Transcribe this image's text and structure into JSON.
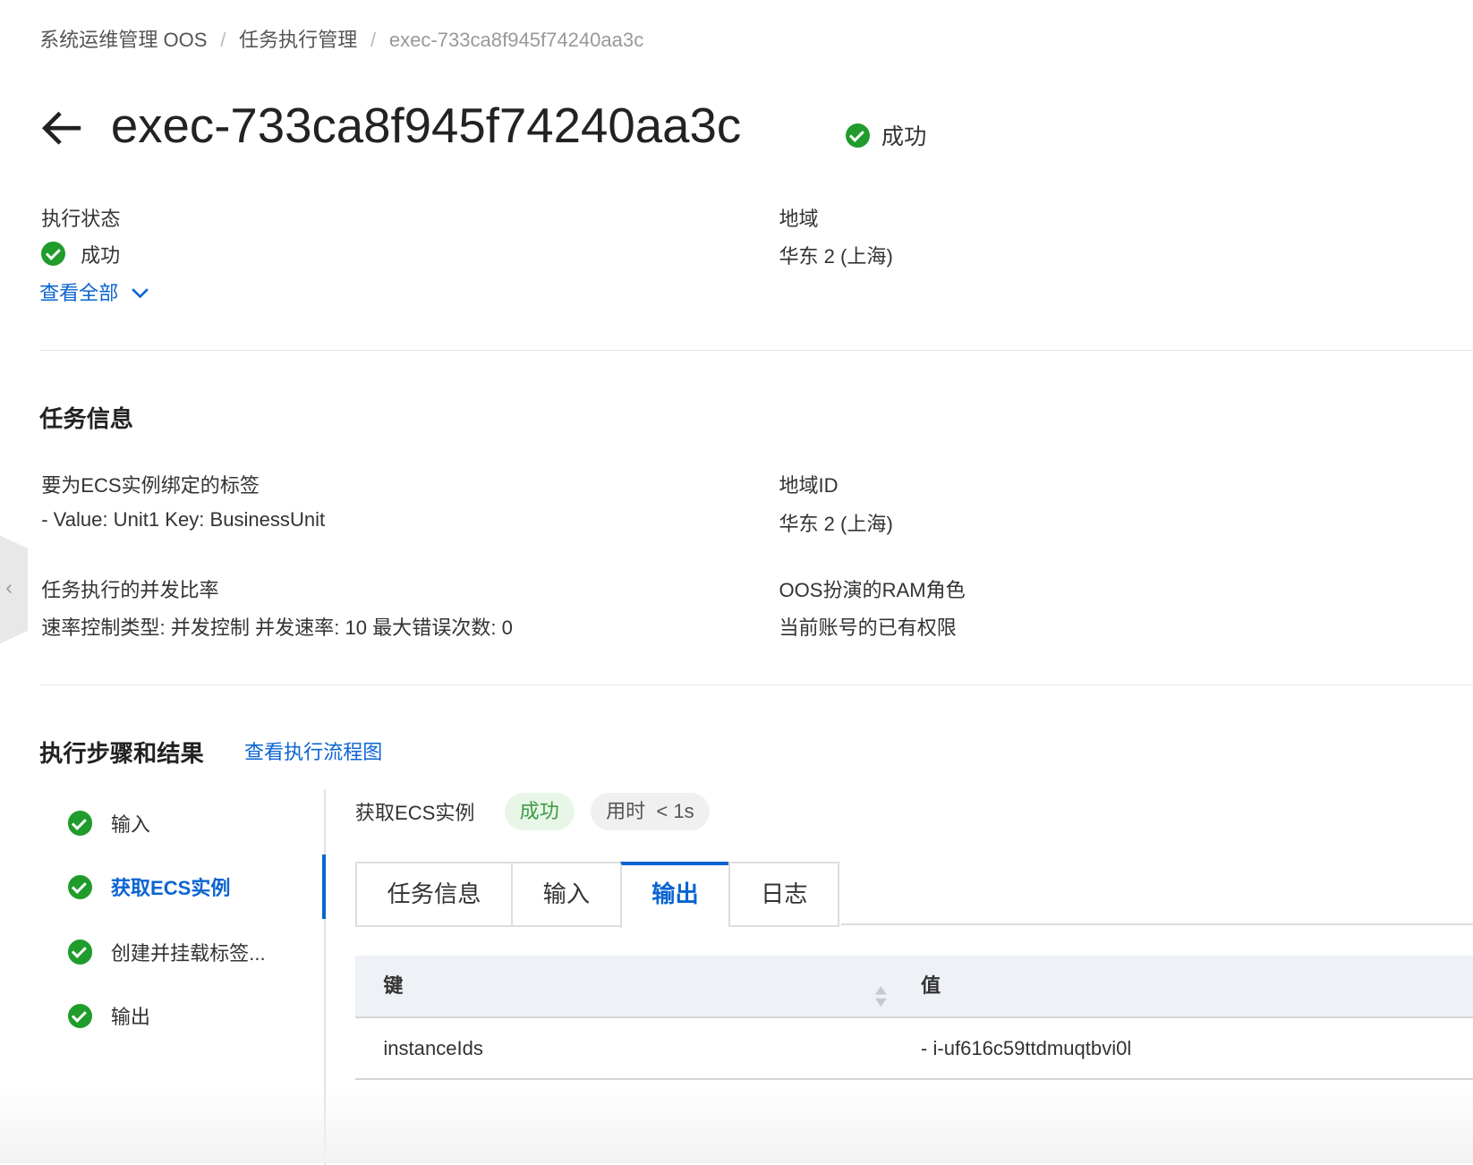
{
  "breadcrumb": [
    "系统运维管理 OOS",
    "任务执行管理",
    "exec-733ca8f945f74240aa3c"
  ],
  "header": {
    "title": "exec-733ca8f945f74240aa3c",
    "status": "成功"
  },
  "summary": {
    "exec_status_label": "执行状态",
    "exec_status_value": "成功",
    "view_all": "查看全部",
    "region_label": "地域",
    "region_value": "华东 2 (上海)"
  },
  "task_info": {
    "title": "任务信息",
    "fields": [
      {
        "label": "要为ECS实例绑定的标签",
        "value": "- Value: Unit1 Key: BusinessUnit"
      },
      {
        "label": "地域ID",
        "value": "华东 2 (上海)"
      },
      {
        "label": "任务执行的并发比率",
        "value": "速率控制类型: 并发控制 并发速率: 10 最大错误次数: 0"
      },
      {
        "label": "OOS扮演的RAM角色",
        "value": "当前账号的已有权限"
      }
    ]
  },
  "steps": {
    "title": "执行步骤和结果",
    "flow_link": "查看执行流程图",
    "items": [
      "输入",
      "获取ECS实例",
      "创建并挂载标签...",
      "输出"
    ],
    "detail": {
      "name": "获取ECS实例",
      "status": "成功",
      "duration": "用时  < 1s"
    },
    "tabs": [
      "任务信息",
      "输入",
      "输出",
      "日志"
    ],
    "table": {
      "headers": [
        "键",
        "值"
      ],
      "rows": [
        [
          "instanceIds",
          "- i-uf616c59ttdmuqtbvi0l"
        ]
      ]
    }
  },
  "colors": {
    "success": "#1f9c2c",
    "link": "#0a64d2"
  }
}
